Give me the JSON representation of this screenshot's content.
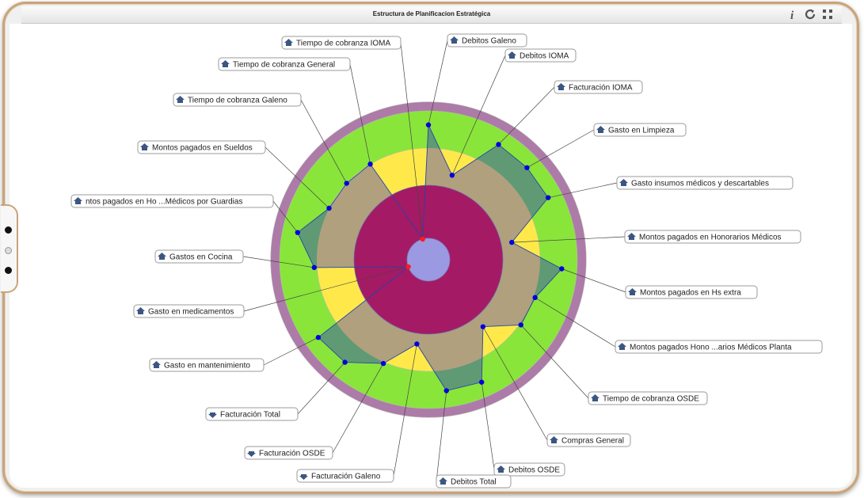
{
  "window": {
    "title": "Estructura de Planificacion Estratégica",
    "icons": [
      "info-icon",
      "refresh-icon",
      "fullscreen-icon"
    ]
  },
  "chart_data": {
    "type": "radar",
    "title": "Estructura de Planificacion Estratégica",
    "center_color": "#9b99e2",
    "bands": [
      {
        "color": "#a51a64",
        "from": 0.0,
        "to": 0.5
      },
      {
        "color": "#ffe94a",
        "from": 0.5,
        "to": 0.75
      },
      {
        "color": "#8ae53a",
        "from": 0.75,
        "to": 1.0
      },
      {
        "color": "#ad7ba8",
        "from": 1.0,
        "to": 1.06
      }
    ],
    "poly_fill": "#b0a07e",
    "over_fill": "#5f9a75",
    "indicators": [
      {
        "label": "Debitos Galeno",
        "value": 0.89,
        "arrow": "up"
      },
      {
        "label": "Debitos IOMA",
        "value": 0.52,
        "arrow": "up"
      },
      {
        "label": "Facturación IOMA",
        "value": 0.89,
        "arrow": "up"
      },
      {
        "label": "Gasto en Limpieza",
        "value": 0.89,
        "arrow": "up"
      },
      {
        "label": "Gasto insumos médicos y descartables",
        "value": 0.89,
        "arrow": "up"
      },
      {
        "label": "Montos pagados en Honorarios Médicos",
        "value": 0.5,
        "arrow": "up"
      },
      {
        "label": "Montos pagados en Hs extra",
        "value": 0.88,
        "arrow": "up"
      },
      {
        "label": "Montos pagados Hono ...arios Médicos Planta",
        "value": 0.72,
        "arrow": "up"
      },
      {
        "label": "Tiempo de cobranza OSDE",
        "value": 0.72,
        "arrow": "up"
      },
      {
        "label": "Compras General",
        "value": 0.51,
        "arrow": "up"
      },
      {
        "label": "Debitos OSDE",
        "value": 0.88,
        "arrow": "up"
      },
      {
        "label": "Debitos Total",
        "value": 0.87,
        "arrow": "up"
      },
      {
        "label": "Facturación Galeno",
        "value": 0.5,
        "arrow": "down"
      },
      {
        "label": "Facturación OSDE",
        "value": 0.72,
        "arrow": "down"
      },
      {
        "label": "Facturación Total",
        "value": 0.87,
        "arrow": "down"
      },
      {
        "label": "Gasto en mantenimiento",
        "value": 0.89,
        "arrow": "up"
      },
      {
        "label": "Gasto en medicamentos",
        "value": 0.0,
        "arrow": "up"
      },
      {
        "label": "Gastos en Cocina",
        "value": 0.73,
        "arrow": "up"
      },
      {
        "label": "ntos pagados en Ho ...Médicos por Guardias",
        "value": 0.88,
        "arrow": "up"
      },
      {
        "label": "Montos pagados en Sueldos",
        "value": 0.71,
        "arrow": "up"
      },
      {
        "label": "Tiempo de cobranza Galeno",
        "value": 0.71,
        "arrow": "up"
      },
      {
        "label": "Tiempo de cobranza General",
        "value": 0.71,
        "arrow": "up"
      },
      {
        "label": "Tiempo de cobranza IOMA",
        "value": 0.0,
        "arrow": "up"
      }
    ]
  }
}
